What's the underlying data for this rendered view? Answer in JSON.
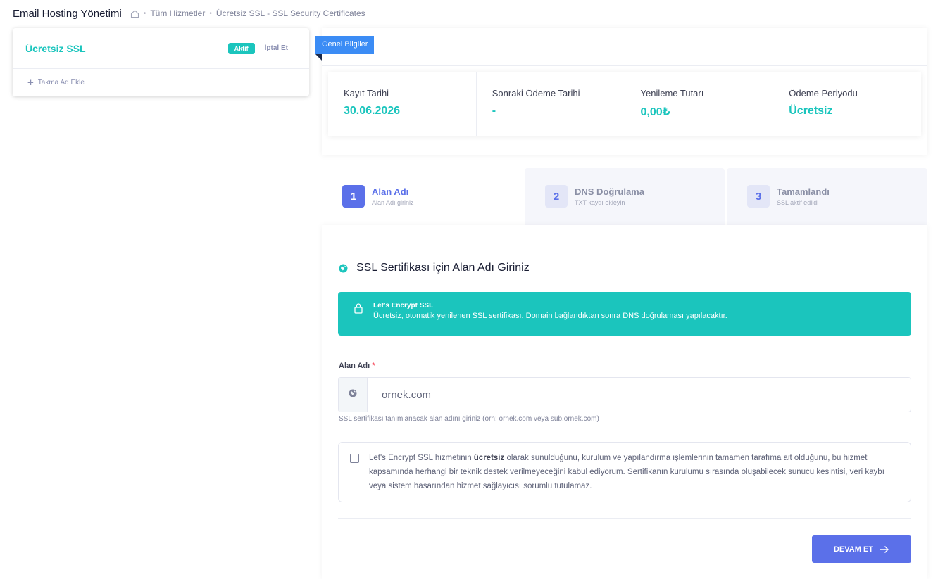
{
  "header": {
    "title": "Email Hosting Yönetimi",
    "breadcrumbs": [
      "Tüm Hizmetler",
      "Ücretsiz SSL - SSL Security Certificates"
    ]
  },
  "service_card": {
    "name": "Ücretsiz SSL",
    "status": "Aktif",
    "cancel_label": "İptal Et",
    "alias_label": "Takma Ad Ekle"
  },
  "info": {
    "ribbon": "Genel Bilgiler",
    "stats": [
      {
        "label": "Kayıt Tarihi",
        "value": "30.06.2026"
      },
      {
        "label": "Sonraki Ödeme Tarihi",
        "value": "-"
      },
      {
        "label": "Yenileme Tutarı",
        "value": "0,00₺"
      },
      {
        "label": "Ödeme Periyodu",
        "value": "Ücretsiz"
      }
    ]
  },
  "steps": [
    {
      "number": "1",
      "title": "Alan Adı",
      "subtitle": "Alan Adı giriniz",
      "active": true
    },
    {
      "number": "2",
      "title": "DNS Doğrulama",
      "subtitle": "TXT kaydı ekleyin",
      "active": false
    },
    {
      "number": "3",
      "title": "Tamamlandı",
      "subtitle": "SSL aktif edildi",
      "active": false
    }
  ],
  "form": {
    "section_title": "SSL Sertifikası için Alan Adı Giriniz",
    "notice": {
      "title": "Let's Encrypt SSL",
      "description": "Ücretsiz, otomatik yenilenen SSL sertifikası. Domain bağlandıktan sonra DNS doğrulaması yapılacaktır."
    },
    "domain_label": "Alan Adı",
    "required_mark": "*",
    "domain_placeholder": "ornek.com",
    "domain_value": "",
    "help_text": "SSL sertifikası tanımlanacak alan adını giriniz (örn: ornek.com veya sub.ornek.com)",
    "agreement": {
      "prefix": "Let's Encrypt SSL hizmetinin ",
      "bold": "ücretsiz",
      "suffix": " olarak sunulduğunu, kurulum ve yapılandırma işlemlerinin tamamen tarafıma ait olduğunu, bu hizmet kapsamında herhangi bir teknik destek verilmeyeceğini kabul ediyorum. Sertifikanın kurulumu sırasında oluşabilecek sunucu kesintisi, veri kaybı veya sistem hasarından hizmet sağlayıcısı sorumlu tutulamaz.",
      "checked": false
    },
    "continue_label": "DEVAM ET"
  },
  "colors": {
    "accent": "#1bc5bd",
    "primary": "#5b70e9",
    "ribbon": "#3b8cf5"
  }
}
